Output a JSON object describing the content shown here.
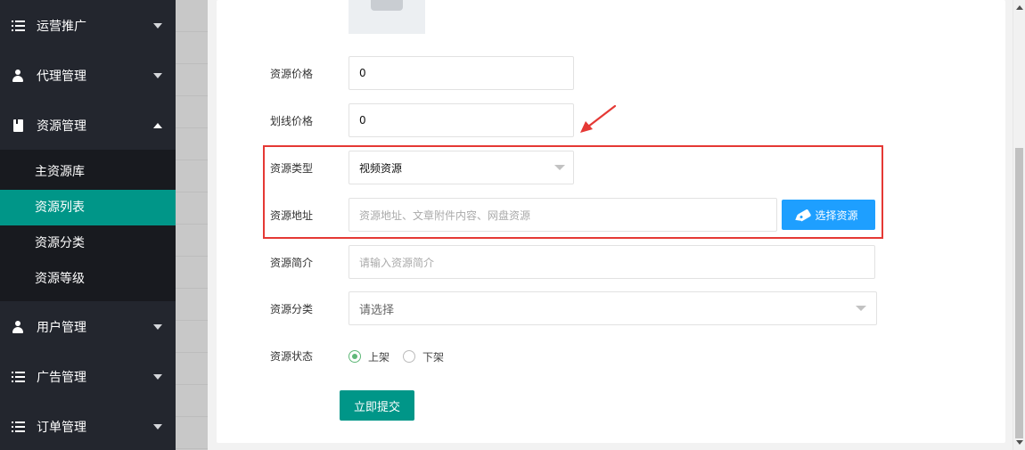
{
  "sidebar": {
    "items": [
      {
        "label": "运营推广",
        "icon": "list-icon"
      },
      {
        "label": "代理管理",
        "icon": "agent-icon"
      },
      {
        "label": "资源管理",
        "icon": "bookmark-icon"
      },
      {
        "label": "用户管理",
        "icon": "user-icon"
      },
      {
        "label": "广告管理",
        "icon": "list-icon"
      },
      {
        "label": "订单管理",
        "icon": "list-icon"
      }
    ],
    "subitems": [
      {
        "label": "主资源库"
      },
      {
        "label": "资源列表",
        "active": true
      },
      {
        "label": "资源分类"
      },
      {
        "label": "资源等级"
      }
    ]
  },
  "form": {
    "price": {
      "label": "资源价格",
      "value": "0"
    },
    "strike_price": {
      "label": "划线价格",
      "value": "0"
    },
    "type": {
      "label": "资源类型",
      "value": "视频资源"
    },
    "address": {
      "label": "资源地址",
      "placeholder": "资源地址、文章附件内容、网盘资源",
      "button": "选择资源"
    },
    "intro": {
      "label": "资源简介",
      "placeholder": "请输入资源简介"
    },
    "category": {
      "label": "资源分类",
      "placeholder": "请选择"
    },
    "status": {
      "label": "资源状态",
      "options": [
        "上架",
        "下架"
      ],
      "selected": "上架"
    },
    "submit": "立即提交"
  },
  "colors": {
    "sidebar_bg": "#23262e",
    "sidebar_active": "#009688",
    "primary_button": "#1e9fff",
    "submit_button": "#009688",
    "highlight_border": "#e53935"
  }
}
